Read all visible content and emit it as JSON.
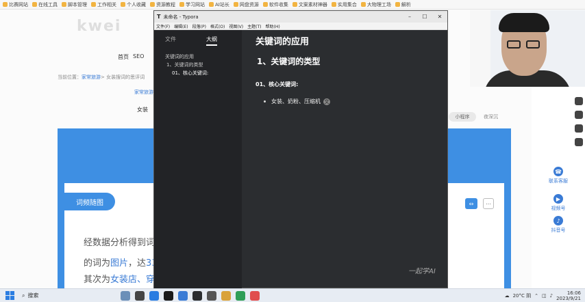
{
  "bookmarks": [
    "比赛网站",
    "在线工具",
    "脚本管理",
    "工作相关",
    "个人收藏",
    "资源教程",
    "学习网站",
    "AI站长",
    "网盘资源",
    "软件收集",
    "文案素材神器",
    "实用集合",
    "大物理工场",
    "解析"
  ],
  "webpage": {
    "logo": "kwei",
    "nav": [
      "首页",
      "SEO"
    ],
    "breadcrumb": [
      "当前位置：",
      "家常旅游",
      "> 女装搜词的思评词"
    ],
    "subtitle": "家常旅游",
    "tag_left": "女装",
    "tag_right": "小程序",
    "tag_right2": "夜深沉",
    "section_pill": "词频随图",
    "ctrl_left": "⇔",
    "ctrl_right": "⋯",
    "text_line1": "经数据分析得到词",
    "text_line2_prefix": "的词为",
    "text_line2_link": "图片",
    "text_line2_mid": "，达",
    "text_line2_num": "33",
    "text_line3_prefix": "其次为",
    "text_line3_link": "女装店、穿",
    "sidebar": [
      {
        "label": "联系客服",
        "icon": "headset-icon"
      },
      {
        "label": "视频号",
        "icon": "video-icon"
      },
      {
        "label": "抖音号",
        "icon": "tiktok-icon"
      }
    ]
  },
  "typora": {
    "title": "未命名 - Typora",
    "menu": [
      "文件(F)",
      "编辑(E)",
      "段落(P)",
      "格式(O)",
      "视图(V)",
      "主题(T)",
      "帮助(H)"
    ],
    "sidebar_tabs": [
      "文件",
      "大纲"
    ],
    "outline": [
      "关键词的应用",
      "1、关键词的类型",
      "01、核心关键词:"
    ],
    "editor": {
      "h1": "关键词的应用",
      "h2": "1、关键词的类型",
      "h3": "01、核心关键词:",
      "bullet": "女装、奶粉、压缩机",
      "cursor": "文"
    }
  },
  "watermark": "一起学AI",
  "taskbar": {
    "search": "搜索",
    "weather": "20°C 阴",
    "time": "16:06",
    "date": "2023/9/21"
  }
}
